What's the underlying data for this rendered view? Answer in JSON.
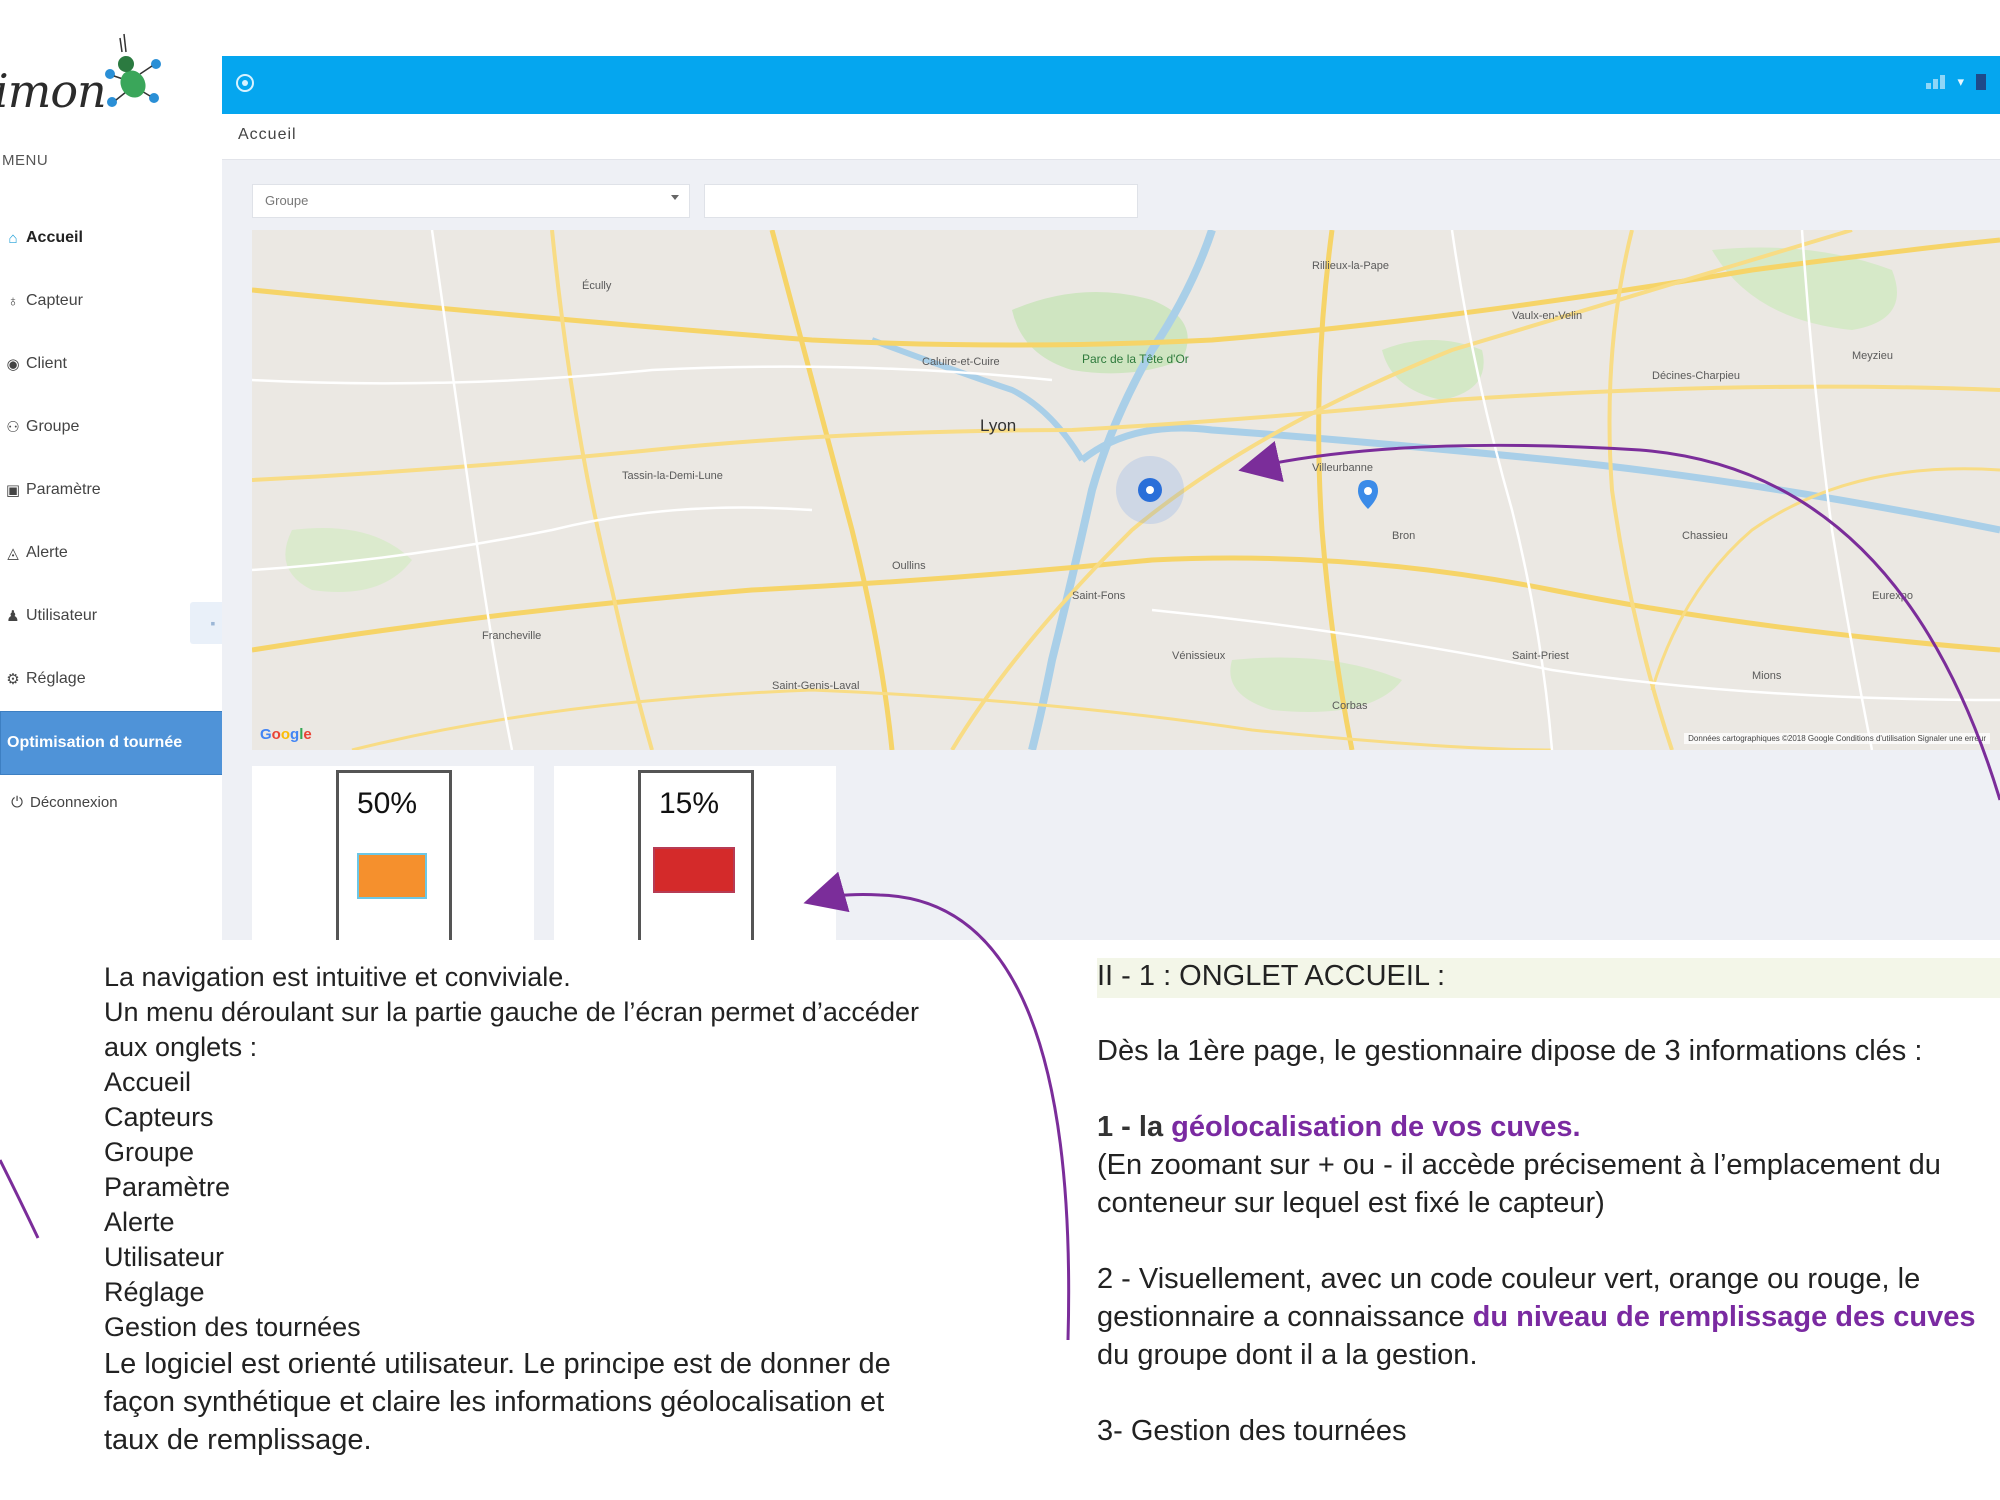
{
  "logo": {
    "text": "imon"
  },
  "sidebar": {
    "menu_title": "MENU",
    "items": [
      {
        "label": "Accueil",
        "icon": "home-icon"
      },
      {
        "label": "Capteur",
        "icon": "sensor-icon"
      },
      {
        "label": "Client",
        "icon": "client-icon"
      },
      {
        "label": "Groupe",
        "icon": "group-icon"
      },
      {
        "label": "Paramètre",
        "icon": "settings-icon"
      },
      {
        "label": "Alerte",
        "icon": "alert-icon"
      },
      {
        "label": "Utilisateur",
        "icon": "user-icon"
      },
      {
        "label": "Réglage",
        "icon": "gear-icon"
      },
      {
        "label": "Optimisation d tournée",
        "icon": ""
      },
      {
        "label": "Déconnexion",
        "icon": "power-icon"
      }
    ]
  },
  "breadcrumb": "Accueil",
  "filters": {
    "group_select": "Groupe",
    "search_value": ""
  },
  "map": {
    "labels": {
      "lyon": "Lyon",
      "park": "Parc de la Tête d'Or",
      "croix_rousse": "Caluire-et-Cuire",
      "villeurbanne": "Villeurbanne",
      "vaulx": "Vaulx-en-Velin",
      "bron": "Bron",
      "venissieux": "Vénissieux",
      "oullins": "Oullins",
      "tassin": "Tassin-la-Demi-Lune",
      "francheville": "Francheville",
      "ecully": "Écully",
      "rillieux": "Rillieux-la-Pape",
      "decines": "Décines-Charpieu",
      "meyzieu": "Meyzieu",
      "stfons": "Saint-Fons",
      "chassieu": "Chassieu",
      "st_priest": "Saint-Priest",
      "st_genis": "Saint-Genis-Laval",
      "mions": "Mions",
      "corbas": "Corbas",
      "airport": "Eurexpo"
    },
    "google": "Google",
    "attribution": "Données cartographiques ©2018 Google   Conditions d'utilisation   Signaler une erreur"
  },
  "tanks": [
    {
      "percent": "50%",
      "color": "#f5902d"
    },
    {
      "percent": "15%",
      "color": "#d42a2a"
    }
  ],
  "description": {
    "left_lines": [
      "La navigation est intuitive et conviviale.",
      "Un menu déroulant sur la partie gauche de l’écran permet d’accéder",
      "aux onglets :",
      "Accueil",
      "Capteurs",
      "Groupe",
      "Paramètre",
      "Alerte",
      "Utilisateur",
      "Réglage",
      "Gestion des tournées"
    ],
    "left_paragraph_lines": [
      "Le logiciel est orienté utilisateur. Le principe est de donner de",
      "façon synthétique et claire les informations géolocalisation et",
      "taux de remplissage."
    ],
    "section_heading": "II - 1 : ONGLET ACCUEIL :",
    "intro": "Dès la 1ère page, le gestionnaire dipose de 3 informations clés :",
    "point1_prefix": "1 - la ",
    "point1_highlight": "géolocalisation de vos cuves.",
    "point1_line2": "(En zoomant sur + ou - il accède précisement à l’emplacement du",
    "point1_line3": "conteneur sur lequel est fixé le capteur)",
    "point2_line1": "2 - Visuellement, avec un code couleur vert, orange ou rouge, le",
    "point2_prefix": "gestionnaire a connaissance ",
    "point2_highlight": "du niveau de remplissage des cuves",
    "point2_line3": "du groupe dont il a la gestion.",
    "point3": "3- Gestion des tournées"
  },
  "colors": {
    "topbar": "#05a6ef",
    "active_menu": "#4f93d8",
    "highlight": "#7a2aa1",
    "arrow": "#7b2d9a"
  }
}
